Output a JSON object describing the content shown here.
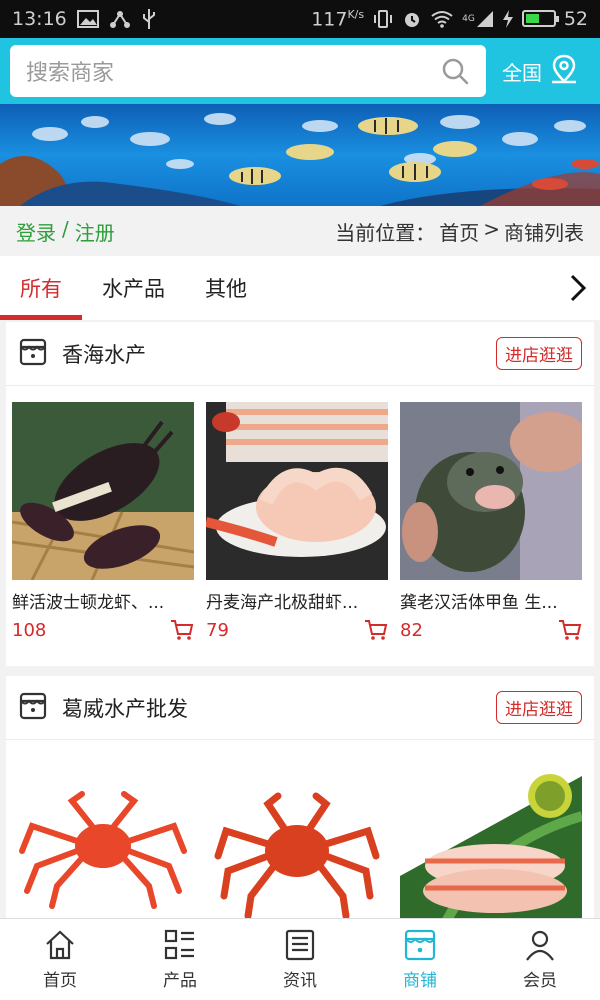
{
  "status_bar": {
    "time": "13:16",
    "speed": "117",
    "speed_unit": "K/s",
    "network": "4G",
    "battery": "52"
  },
  "header": {
    "search_placeholder": "搜索商家",
    "region_label": "全国"
  },
  "crumbs": {
    "login": "登录",
    "sep": "/",
    "register": "注册",
    "location_label": "当前位置：",
    "home": "首页",
    "arrow": ">",
    "current": "商铺列表"
  },
  "tabs": [
    {
      "label": "所有"
    },
    {
      "label": "水产品"
    },
    {
      "label": "其他"
    }
  ],
  "shops": [
    {
      "name": "香海水产",
      "enter_label": "进店逛逛",
      "products": [
        {
          "title": "鲜活波士顿龙虾、...",
          "price": "108"
        },
        {
          "title": "丹麦海产北极甜虾...",
          "price": "79"
        },
        {
          "title": "龚老汉活体甲鱼 生...",
          "price": "82"
        }
      ]
    },
    {
      "name": "葛威水产批发",
      "enter_label": "进店逛逛",
      "products": [
        {
          "title": "",
          "price": ""
        },
        {
          "title": "",
          "price": ""
        },
        {
          "title": "",
          "price": ""
        }
      ]
    }
  ],
  "bottom_nav": [
    {
      "label": "首页",
      "icon": "home-icon"
    },
    {
      "label": "产品",
      "icon": "list-icon"
    },
    {
      "label": "资讯",
      "icon": "news-icon"
    },
    {
      "label": "商铺",
      "icon": "shop-icon",
      "active": true
    },
    {
      "label": "会员",
      "icon": "user-icon"
    }
  ],
  "colors": {
    "header": "#20c4e0",
    "accent": "#d42b2b",
    "login_green": "#2f9e3a",
    "nav_active": "#20b7d6"
  }
}
